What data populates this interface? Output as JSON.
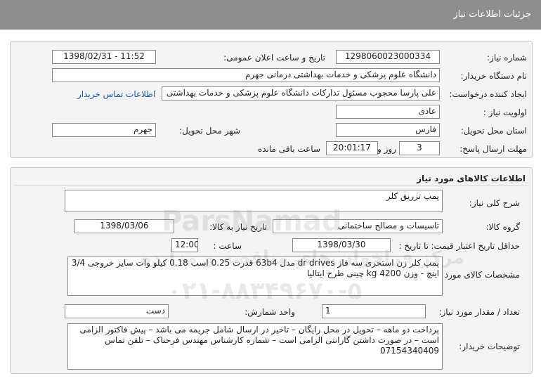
{
  "header": {
    "title": "جزئیات اطلاعات نیاز"
  },
  "need_info": {
    "need_number_label": "شماره نیاز:",
    "need_number": "1298060023000334",
    "announce_label": "تاریخ و ساعت اعلان عمومی:",
    "announce_value": "1398/02/31 - 11:52",
    "buyer_org_label": "نام دستگاه خریدار:",
    "buyer_org": "دانشگاه علوم پزشکی و خدمات بهداشتی درمانی جهرم",
    "requester_label": "ایجاد کننده درخواست:",
    "requester": "علی پارسا محجوب مسئول تدارکات دانشگاه علوم پزشکی و خدمات بهداشتی",
    "contact_link": "اطلاعات تماس خریدار",
    "priority_label": "اولویت نیاز :",
    "priority": "عادی",
    "province_label": "استان محل تحویل:",
    "province": "فارس",
    "city_label": "شهر محل تحویل:",
    "city": "جهرم",
    "deadline_label": "مهلت ارسال پاسخ:",
    "deadline_days": "3",
    "days_word": "روز و",
    "deadline_time": "20:01:17",
    "remaining_text": "ساعت باقی مانده"
  },
  "goods": {
    "section_title": "اطلاعات کالاهای مورد نیاز",
    "general_desc_label": "شرح کلی نیاز:",
    "general_desc": "پمپ تزریق کلر",
    "group_label": "گروه کالا:",
    "group": "تاسیسات و مصالح ساختمانی",
    "need_date_label": "تاریخ نیاز به کالا:",
    "need_date": "1398/03/06",
    "validity_label": "حداقل تاریخ اعتبار قیمت:",
    "validity_until": "تا تاریخ :",
    "validity_date": "1398/03/30",
    "time_label": "ساعت :",
    "validity_time": "12:00",
    "spec_label": "مشخصات کالای مورد نیاز:",
    "spec": "پمپ کلر زن استخری سه فاز dr drives مدل 63b4 قدرت 0.25 اسب 0.18 کیلو وات سایز خروجی 3/4 اینچ - وزن kg 4200 چینی طرح ایتالیا",
    "qty_label": "تعداد / مقدار مورد نیاز:",
    "qty": "1",
    "unit_label": "واحد شمارش:",
    "unit": "دست",
    "buyer_notes_label": "توضیحات خریدار:",
    "buyer_notes": "پرداخت دو ماهه – تحویل در محل رایگان – تاخیر در ارسال شامل جریمه می باشد – پیش فاکتور الزامی است – در صورت داشتن گارانتی الزامی است – شماره کارشناس مهندس فرحناک – تلفن تماس 07154340409"
  },
  "watermark": {
    "line1": "ParsNamad",
    "line2": "مرکز فراخوان های مناقصه و مزایده",
    "line3": "۰۲۱-۸۸۳۴۹۶۷۰-۵"
  }
}
